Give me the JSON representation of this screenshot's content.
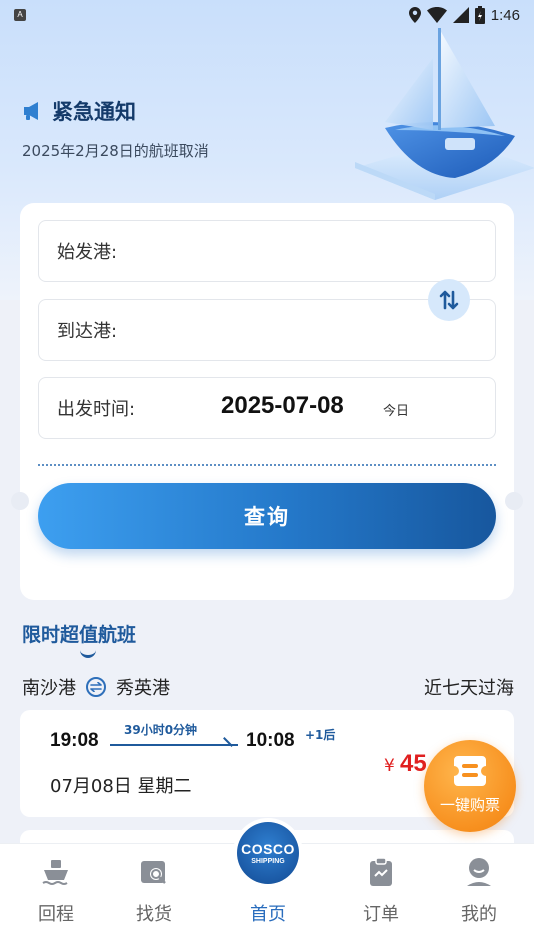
{
  "status_bar": {
    "app_badge": "A",
    "time": "1:46",
    "icons": [
      "location-icon",
      "wifi-icon",
      "signal-icon",
      "battery-icon"
    ]
  },
  "notice": {
    "icon": "megaphone-icon",
    "title": "紧急通知",
    "subtitle": "2025年2月28日的航班取消"
  },
  "search": {
    "departure_label": "始发港:",
    "arrival_label": "到达港:",
    "date_label": "出发时间:",
    "date_value": "2025-07-08",
    "date_tag": "今日",
    "swap_icon": "swap-vertical-icon",
    "query_button": "查询"
  },
  "deals": {
    "section_title": "限时超值航班",
    "route": {
      "from": "南沙港",
      "to": "秀英港",
      "period": "近七天过海"
    },
    "flights": [
      {
        "depart_time": "19:08",
        "duration": "39小时0分钟",
        "arrive_time": "10:08",
        "day_offset": "+1后",
        "date": "07月08日 星期二",
        "currency": "¥",
        "price": "45"
      }
    ]
  },
  "fab": {
    "icon": "ticket-icon",
    "label": "一键购票"
  },
  "logo": {
    "line1": "COSCO",
    "line2": "SHIPPING"
  },
  "nav": {
    "items": [
      {
        "label": "回程",
        "icon": "ship-icon"
      },
      {
        "label": "找货",
        "icon": "cargo-search-icon"
      },
      {
        "label": "首页",
        "icon": "home-logo"
      },
      {
        "label": "订单",
        "icon": "clipboard-icon"
      },
      {
        "label": "我的",
        "icon": "user-icon"
      }
    ],
    "active_index": 2
  },
  "colors": {
    "primary": "#2a6dbd",
    "price": "#e02020",
    "fab": "#f7901f",
    "title": "#143a6a"
  }
}
